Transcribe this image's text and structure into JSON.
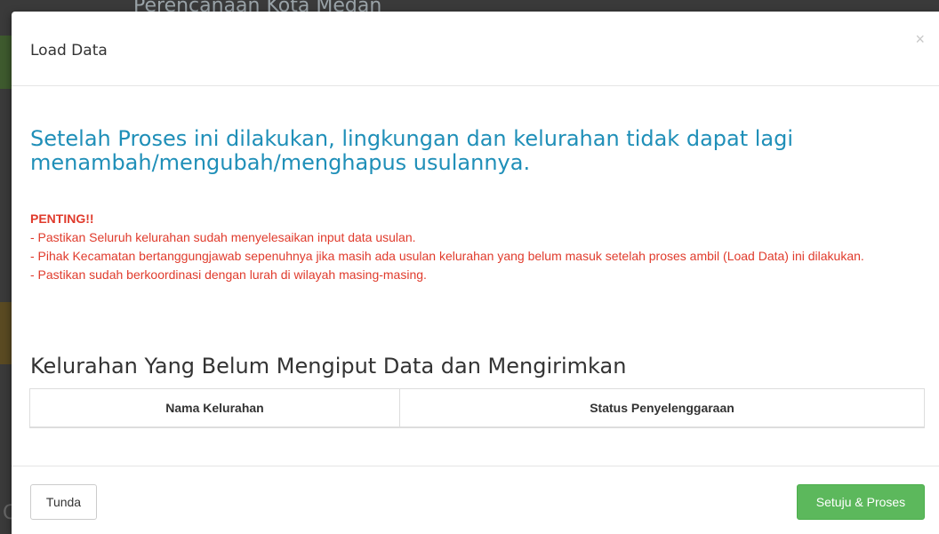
{
  "background": {
    "page_title": "Perencanaan Kota Medan",
    "edge_letter": "C"
  },
  "modal": {
    "title": "Load Data",
    "close_label": "×",
    "headline": "Setelah Proses ini dilakukan, lingkungan dan kelurahan tidak dapat lagi menambah/mengubah/menghapus usulannya.",
    "warning": {
      "heading": "PENTING!!",
      "lines": [
        "- Pastikan Seluruh kelurahan sudah menyelesaikan input data usulan.",
        "- Pihak Kecamatan bertanggungjawab sepenuhnya jika masih ada usulan kelurahan yang belum masuk setelah proses ambil (Load Data) ini dilakukan.",
        "- Pastikan sudah berkoordinasi dengan lurah di wilayah masing-masing."
      ]
    },
    "section_title": "Kelurahan Yang Belum Mengiput Data dan Mengirimkan",
    "table": {
      "columns": [
        "Nama Kelurahan",
        "Status Penyelenggaraan"
      ],
      "rows": []
    },
    "footer": {
      "cancel_label": "Tunda",
      "confirm_label": "Setuju & Proses"
    }
  },
  "colors": {
    "headline": "#1f8fb8",
    "warning": "#e03b2c",
    "confirm_button": "#5cb85c"
  }
}
